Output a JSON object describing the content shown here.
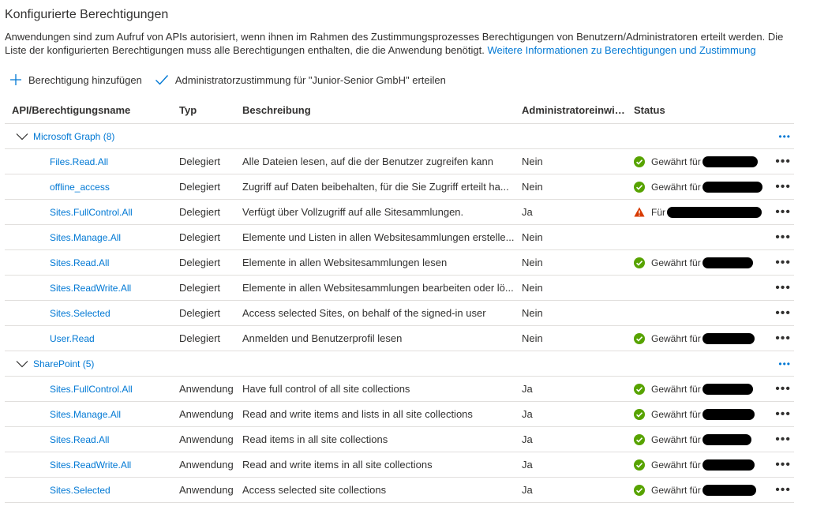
{
  "page": {
    "title": "Konfigurierte Berechtigungen",
    "description": "Anwendungen sind zum Aufruf von APIs autorisiert, wenn ihnen im Rahmen des Zustimmungsprozesses Berechtigungen von Benutzern/Administratoren erteilt werden. Die Liste der konfigurierten Berechtigungen muss alle Berechtigungen enthalten, die die Anwendung benötigt.",
    "link": "Weitere Informationen zu Berechtigungen und Zustimmung"
  },
  "toolbar": {
    "add_label": "Berechtigung hinzufügen",
    "consent_label": "Administratorzustimmung für \"Junior-Senior GmbH\" erteilen"
  },
  "table": {
    "headers": [
      "API/Berechtigungsname",
      "Typ",
      "Beschreibung",
      "Administratoreinwill...",
      "Status"
    ],
    "groups": [
      {
        "label": "Microsoft Graph (8)",
        "rows": [
          {
            "name": "Files.Read.All",
            "type": "Delegiert",
            "desc": "Alle Dateien lesen, auf die der Benutzer zugreifen kann",
            "admin": "Nein",
            "status": "Gewährt für",
            "icon": "check-circle-icon"
          },
          {
            "name": "offline_access",
            "type": "Delegiert",
            "desc": "Zugriff auf Daten beibehalten, für die Sie Zugriff erteilt ha...",
            "admin": "Nein",
            "status": "Gewährt für",
            "icon": "check-circle-icon"
          },
          {
            "name": "Sites.FullControl.All",
            "type": "Delegiert",
            "desc": "Verfügt über Vollzugriff auf alle Sitesammlungen.",
            "admin": "Ja",
            "status": "Für",
            "icon": "warning-icon"
          },
          {
            "name": "Sites.Manage.All",
            "type": "Delegiert",
            "desc": "Elemente und Listen in allen Websitesammlungen erstelle...",
            "admin": "Nein",
            "status": "",
            "icon": ""
          },
          {
            "name": "Sites.Read.All",
            "type": "Delegiert",
            "desc": "Elemente in allen Websitesammlungen lesen",
            "admin": "Nein",
            "status": "Gewährt für",
            "icon": "check-circle-icon"
          },
          {
            "name": "Sites.ReadWrite.All",
            "type": "Delegiert",
            "desc": "Elemente in allen Websitesammlungen bearbeiten oder lö...",
            "admin": "Nein",
            "status": "",
            "icon": ""
          },
          {
            "name": "Sites.Selected",
            "type": "Delegiert",
            "desc": "Access selected Sites, on behalf of the signed-in user",
            "admin": "Nein",
            "status": "",
            "icon": ""
          },
          {
            "name": "User.Read",
            "type": "Delegiert",
            "desc": "Anmelden und Benutzerprofil lesen",
            "admin": "Nein",
            "status": "Gewährt für",
            "icon": "check-circle-icon"
          }
        ]
      },
      {
        "label": "SharePoint (5)",
        "rows": [
          {
            "name": "Sites.FullControl.All",
            "type": "Anwendung",
            "desc": "Have full control of all site collections",
            "admin": "Ja",
            "status": "Gewährt für",
            "icon": "check-circle-icon"
          },
          {
            "name": "Sites.Manage.All",
            "type": "Anwendung",
            "desc": "Read and write items and lists in all site collections",
            "admin": "Ja",
            "status": "Gewährt für",
            "icon": "check-circle-icon"
          },
          {
            "name": "Sites.Read.All",
            "type": "Anwendung",
            "desc": "Read items in all site collections",
            "admin": "Ja",
            "status": "Gewährt für",
            "icon": "check-circle-icon"
          },
          {
            "name": "Sites.ReadWrite.All",
            "type": "Anwendung",
            "desc": "Read and write items in all site collections",
            "admin": "Ja",
            "status": "Gewährt für",
            "icon": "check-circle-icon"
          },
          {
            "name": "Sites.Selected",
            "type": "Anwendung",
            "desc": "Access selected site collections",
            "admin": "Ja",
            "status": "Gewährt für",
            "icon": "check-circle-icon"
          }
        ]
      }
    ],
    "more_label": "•••"
  },
  "colors": {
    "link": "#0078d4",
    "success": "#57a300",
    "warning": "#d83b01",
    "redaction": "#000000"
  }
}
